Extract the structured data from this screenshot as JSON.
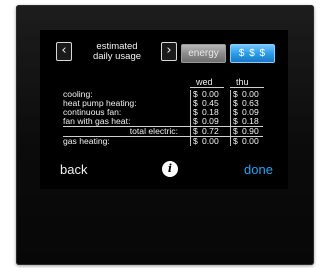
{
  "header": {
    "title_line1": "estimated",
    "title_line2": "daily usage",
    "prev_icon": "chevron-left-icon",
    "next_icon": "chevron-right-icon"
  },
  "tabs": {
    "energy_label": "energy",
    "cost_label": "$ $ $",
    "selected": "$ $ $"
  },
  "table": {
    "columns": [
      "wed",
      "thu"
    ],
    "currency": "$",
    "rows": [
      {
        "label": "cooling:",
        "wed": "0.00",
        "thu": "0.00"
      },
      {
        "label": "heat pump heating:",
        "wed": "0.45",
        "thu": "0.63"
      },
      {
        "label": "continuous fan:",
        "wed": "0.18",
        "thu": "0.09"
      },
      {
        "label": "fan with gas heat:",
        "wed": "0.09",
        "thu": "0.18"
      },
      {
        "label": "total electric:",
        "wed": "0.72",
        "thu": "0.90"
      },
      {
        "label": "gas heating:",
        "wed": "0.00",
        "thu": "0.00"
      }
    ]
  },
  "footer": {
    "back_label": "back",
    "info_icon": "info-icon",
    "info_glyph": "i",
    "done_label": "done"
  },
  "colors": {
    "accent_blue": "#2aa3ee",
    "selected_tab": "#2d9ee8",
    "unselected_tab": "#8c8c8c",
    "screen_bg": "#000000"
  }
}
